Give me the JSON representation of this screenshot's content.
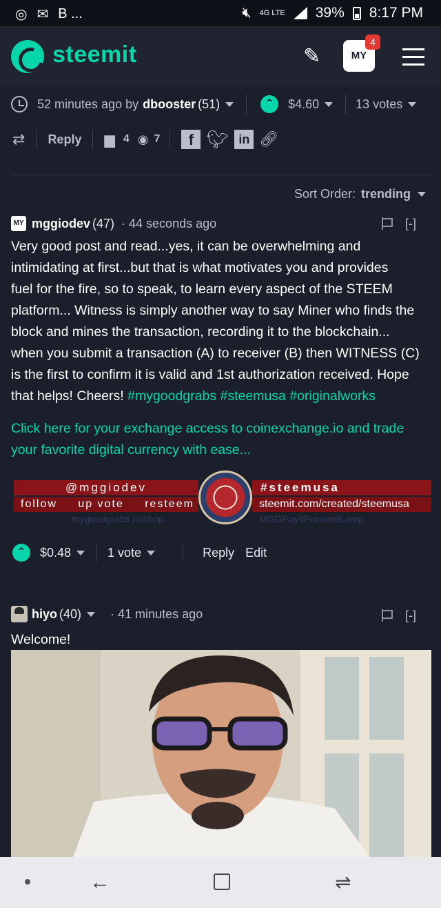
{
  "status_bar": {
    "left_label": "B ...",
    "network": "4G LTE",
    "battery": "39%",
    "time": "8:17 PM"
  },
  "header": {
    "logo_text": "steemit",
    "notification_count": "4",
    "avatar_text": "MY"
  },
  "post_meta": {
    "time_ago": "52 minutes ago by",
    "author": "dbooster",
    "author_rep": "(51)",
    "payout": "$4.60",
    "votes": "13 votes"
  },
  "post_actions": {
    "reply": "Reply",
    "comments_count": "4",
    "views_count": "7"
  },
  "sort": {
    "label": "Sort Order:",
    "value": "trending"
  },
  "comments": [
    {
      "author": "mggiodev",
      "rep": "(47)",
      "time": "· 44 seconds ago",
      "collapse": "[-]",
      "avatar_text": "MY",
      "body_lines": [
        "Very good post and read...yes, it can be overwhelming and",
        "intimidating at first...but that is what motivates you and provides",
        "fuel for the fire, so to speak, to learn every aspect of the STEEM",
        "platform... Witness is simply another way to say Miner who finds the",
        "block and mines the transaction, recording it to the blockchain...",
        "when you submit a transaction (A) to receiver (B) then WITNESS (C)",
        "is the first to confirm it is valid and 1st authorization received. Hope"
      ],
      "last_line_prefix": "that helps! Cheers! ",
      "tags": "#mygoodgrabs #steemusa #originalworks",
      "promo_link_line1": "Click here for your exchange access to coinexchange.io and trade",
      "promo_link_line2": "your favorite digital currency with ease...",
      "banner": {
        "handle": "@mggiodev",
        "follow": "follow",
        "upvote": "up vote",
        "resteem": "resteem",
        "hashtag": "#steemusa",
        "url": "steemit.com/created/steemusa",
        "faint_left": "mygoodgrabs.io/shop",
        "faint_right": "MGGPayItForwardLamp"
      },
      "payout": "$0.48",
      "votes": "1 vote",
      "reply": "Reply",
      "edit": "Edit"
    },
    {
      "author": "hiyo",
      "rep": "(40)",
      "time": "· 41 minutes ago",
      "collapse": "[-]",
      "body": "Welcome!"
    }
  ]
}
